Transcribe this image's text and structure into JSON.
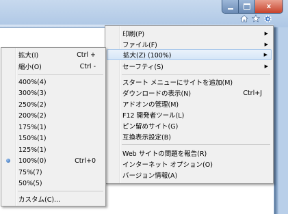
{
  "window": {
    "minimize_glyph": "",
    "maximize_glyph": "",
    "close_glyph": "x"
  },
  "toolbar": {
    "icons": [
      "home-icon",
      "star-icon",
      "gear-icon"
    ]
  },
  "main_menu": {
    "items": [
      {
        "label": "印刷(P)",
        "shortcut": "",
        "submenu": true
      },
      {
        "label": "ファイル(F)",
        "shortcut": "",
        "submenu": true
      },
      {
        "label": "拡大(Z) (100%)",
        "shortcut": "",
        "submenu": true
      },
      {
        "label": "セーフティ(S)",
        "shortcut": "",
        "submenu": true
      },
      {
        "label": "スタート メニューにサイトを追加(M)",
        "shortcut": ""
      },
      {
        "label": "ダウンロードの表示(N)",
        "shortcut": "Ctrl+J"
      },
      {
        "label": "アドオンの管理(M)",
        "shortcut": ""
      },
      {
        "label": "F12 開発者ツール(L)",
        "shortcut": ""
      },
      {
        "label": "ピン留めサイト(G)",
        "shortcut": ""
      },
      {
        "label": "互換表示設定(B)",
        "shortcut": ""
      },
      {
        "label": "Web サイトの問題を報告(R)",
        "shortcut": ""
      },
      {
        "label": "インターネット オプション(O)",
        "shortcut": ""
      },
      {
        "label": "バージョン情報(A)",
        "shortcut": ""
      }
    ],
    "arrow_glyph": "▶"
  },
  "zoom_menu": {
    "items": [
      {
        "label": "拡大(I)",
        "shortcut": "Ctrl +"
      },
      {
        "label": "縮小(O)",
        "shortcut": "Ctrl -"
      },
      {
        "label": "400%(4)",
        "shortcut": ""
      },
      {
        "label": "300%(3)",
        "shortcut": ""
      },
      {
        "label": "250%(2)",
        "shortcut": ""
      },
      {
        "label": "200%(2)",
        "shortcut": ""
      },
      {
        "label": "175%(1)",
        "shortcut": ""
      },
      {
        "label": "150%(1)",
        "shortcut": ""
      },
      {
        "label": "125%(1)",
        "shortcut": ""
      },
      {
        "label": "100%(0)",
        "shortcut": "Ctrl+0",
        "checked": true
      },
      {
        "label": "75%(7)",
        "shortcut": ""
      },
      {
        "label": "50%(5)",
        "shortcut": ""
      },
      {
        "label": "カスタム(C)...",
        "shortcut": ""
      }
    ]
  }
}
